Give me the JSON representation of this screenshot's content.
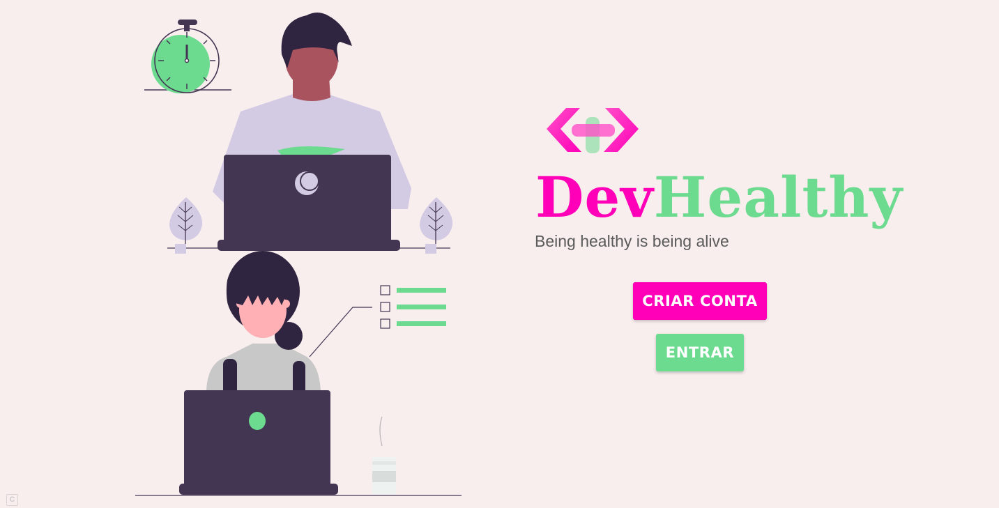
{
  "brand": {
    "name_part1": "Dev",
    "name_part2": "Healthy",
    "tagline": "Being healthy is being alive"
  },
  "actions": {
    "create_account_label": "CRIAR CONTA",
    "login_label": "ENTRAR"
  },
  "footer": {
    "badge_glyph": "C"
  },
  "colors": {
    "background": "#f9eeee",
    "primary_pink": "#ff00b8",
    "primary_green": "#6ddb8f",
    "dark_purple": "#433653",
    "light_purple": "#d3cae4"
  }
}
